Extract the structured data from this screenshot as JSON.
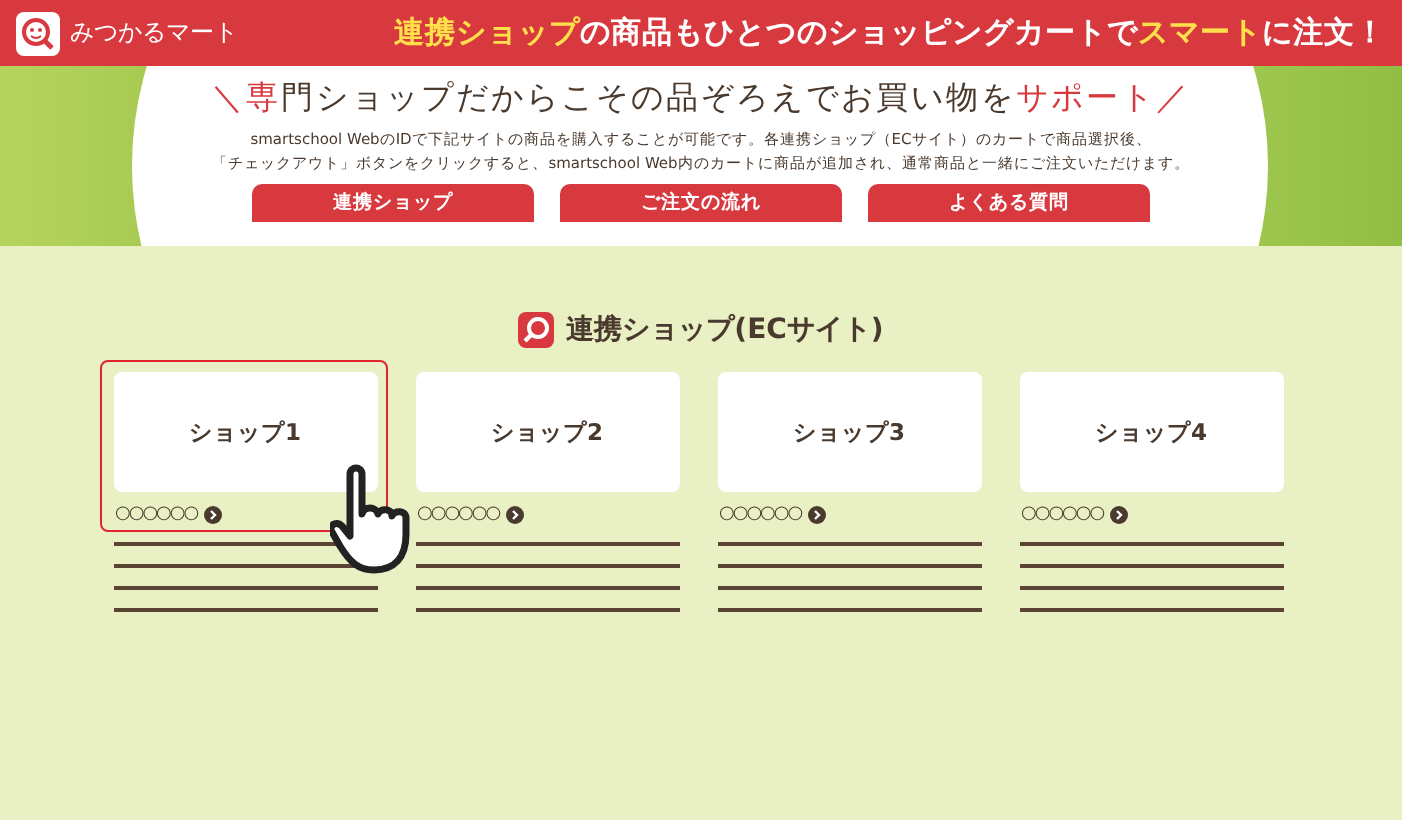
{
  "header": {
    "logo_text": "みつかるマート",
    "tagline": [
      {
        "text": "連携ショップ",
        "highlight": true
      },
      {
        "text": "の商品もひとつのショッピングカートで",
        "highlight": false
      },
      {
        "text": "スマート",
        "highlight": true
      },
      {
        "text": "に注文！",
        "highlight": false
      }
    ]
  },
  "intro": {
    "heading": [
      {
        "text": "＼",
        "highlight": true
      },
      {
        "text": "専",
        "highlight": true
      },
      {
        "text": "門ショップだからこその品ぞろえでお買い物を",
        "highlight": false
      },
      {
        "text": "サポート",
        "highlight": true
      },
      {
        "text": "／",
        "highlight": true
      }
    ],
    "description": [
      "smartschool WebのIDで下記サイトの商品を購入することが可能です。各連携ショップ（ECサイト）のカートで商品選択後、",
      "「チェックアウト」ボタンをクリックすると、smartschool Web内のカートに商品が追加され、通常商品と一緒にご注文いただけます。"
    ],
    "buttons": [
      "連携ショップ",
      "ご注文の流れ",
      "よくある質問"
    ]
  },
  "section": {
    "title": "連携ショップ(ECサイト)",
    "shops": [
      {
        "name": "ショップ1",
        "link": "○○○○○○",
        "selected": true
      },
      {
        "name": "ショップ2",
        "link": "○○○○○○",
        "selected": false
      },
      {
        "name": "ショップ3",
        "link": "○○○○○○",
        "selected": false
      },
      {
        "name": "ショップ4",
        "link": "○○○○○○",
        "selected": false
      }
    ]
  }
}
